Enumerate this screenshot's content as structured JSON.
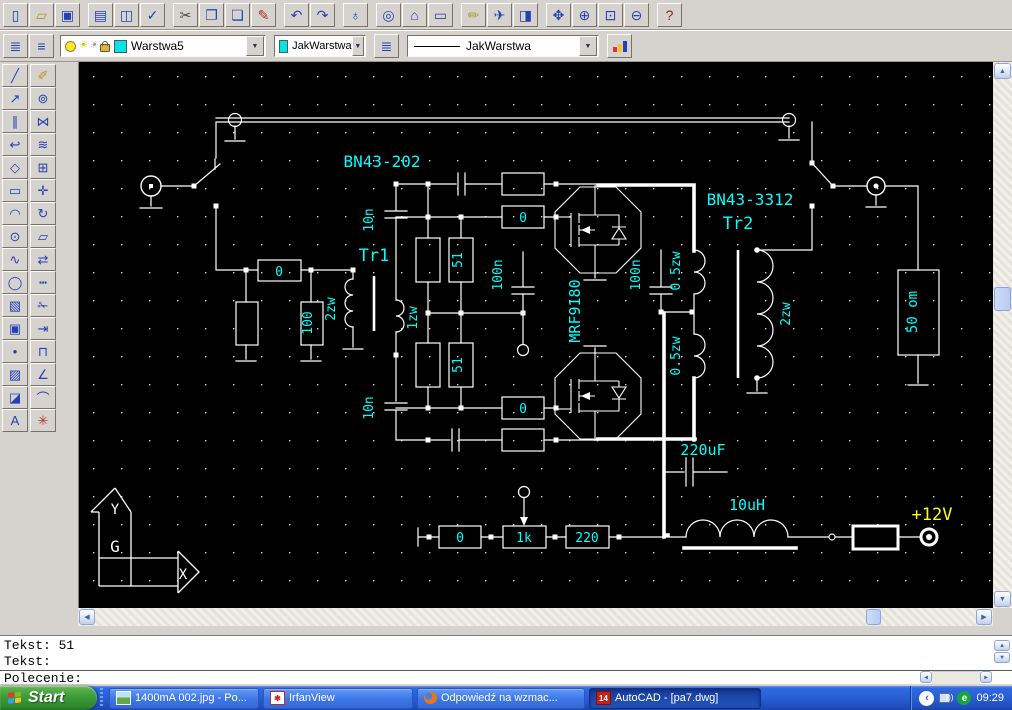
{
  "toolbars": {
    "standard": {
      "buttons": [
        {
          "name": "new",
          "glyph": "▯",
          "color": "#2440b4",
          "group": 1
        },
        {
          "name": "open",
          "glyph": "▱",
          "color": "#b8922a",
          "group": 1
        },
        {
          "name": "save",
          "glyph": "▣",
          "color": "#2440b4",
          "group": 1
        },
        {
          "name": "print",
          "glyph": "▤",
          "color": "#2440b4",
          "group": 2
        },
        {
          "name": "print-preview",
          "glyph": "◫",
          "color": "#2440b4",
          "group": 2
        },
        {
          "name": "spell-check",
          "glyph": "✓",
          "color": "#2440b4",
          "group": 2
        },
        {
          "name": "cut",
          "glyph": "✂",
          "color": "#44464a",
          "group": 3
        },
        {
          "name": "copy",
          "glyph": "❐",
          "color": "#2440b4",
          "group": 3
        },
        {
          "name": "paste",
          "glyph": "❏",
          "color": "#2440b4",
          "group": 3
        },
        {
          "name": "match-properties",
          "glyph": "✎",
          "color": "#b03030",
          "group": 3
        },
        {
          "name": "undo",
          "glyph": "↶",
          "color": "#2440b4",
          "group": 4
        },
        {
          "name": "redo",
          "glyph": "↷",
          "color": "#2440b4",
          "group": 4
        },
        {
          "name": "launch-browser",
          "glyph": "♁",
          "color": "#2440b4",
          "group": 5
        },
        {
          "name": "object-snap",
          "glyph": "◎",
          "color": "#2440b4",
          "group": 6
        },
        {
          "name": "insert-block",
          "glyph": "⌂",
          "color": "#2440b4",
          "group": 6
        },
        {
          "name": "measure",
          "glyph": "▭",
          "color": "#2440b4",
          "group": 6
        },
        {
          "name": "redraw",
          "glyph": "✏",
          "color": "#b8922a",
          "group": 7
        },
        {
          "name": "aerial-view",
          "glyph": "✈",
          "color": "#2440b4",
          "group": 7
        },
        {
          "name": "named-views",
          "glyph": "◨",
          "color": "#2440b4",
          "group": 7
        },
        {
          "name": "pan",
          "glyph": "✥",
          "color": "#2440b4",
          "group": 8
        },
        {
          "name": "zoom-realtime",
          "glyph": "⊕",
          "color": "#2440b4",
          "group": 8
        },
        {
          "name": "zoom-window",
          "glyph": "⊡",
          "color": "#2440b4",
          "group": 8
        },
        {
          "name": "zoom-previous",
          "glyph": "⊖",
          "color": "#2440b4",
          "group": 8
        },
        {
          "name": "help",
          "glyph": "?",
          "color": "#8a1f1f",
          "group": 9
        }
      ]
    },
    "properties": {
      "layers_button_glyph": "≣",
      "layer_stack_button_glyph": "≡",
      "layer_combo": {
        "value": "Warstwa5",
        "swatch": "#00e5e5"
      },
      "color_combo": {
        "value": "JakWarstwa",
        "swatch": "#00e5e5"
      },
      "linetype_button_glyph": "≣",
      "linetype_combo": {
        "value": "JakWarstwa"
      },
      "dropdown_glyph": "▼"
    },
    "draw": {
      "buttons": [
        {
          "name": "line",
          "glyph": "╱"
        },
        {
          "name": "construction-line",
          "glyph": "↗"
        },
        {
          "name": "multiline",
          "glyph": "∥"
        },
        {
          "name": "polyline",
          "glyph": "↩"
        },
        {
          "name": "polygon",
          "glyph": "◇"
        },
        {
          "name": "rectangle",
          "glyph": "▭"
        },
        {
          "name": "arc",
          "glyph": "◠"
        },
        {
          "name": "circle",
          "glyph": "⊙"
        },
        {
          "name": "spline",
          "glyph": "∿"
        },
        {
          "name": "ellipse",
          "glyph": "◯"
        },
        {
          "name": "insert-block",
          "glyph": "▧"
        },
        {
          "name": "make-block",
          "glyph": "▣"
        },
        {
          "name": "point",
          "glyph": "•"
        },
        {
          "name": "hatch",
          "glyph": "▨"
        },
        {
          "name": "region",
          "glyph": "◪"
        },
        {
          "name": "text",
          "glyph": "A"
        }
      ]
    },
    "modify": {
      "buttons": [
        {
          "name": "erase",
          "glyph": "✐",
          "color": "#b8922a"
        },
        {
          "name": "copy-object",
          "glyph": "⊚"
        },
        {
          "name": "mirror",
          "glyph": "⋈"
        },
        {
          "name": "offset",
          "glyph": "≋"
        },
        {
          "name": "array",
          "glyph": "⊞"
        },
        {
          "name": "move",
          "glyph": "✛"
        },
        {
          "name": "rotate",
          "glyph": "↻"
        },
        {
          "name": "scale",
          "glyph": "▱"
        },
        {
          "name": "stretch",
          "glyph": "⇄"
        },
        {
          "name": "lengthen",
          "glyph": "┅"
        },
        {
          "name": "trim",
          "glyph": "✁"
        },
        {
          "name": "extend",
          "glyph": "⇥"
        },
        {
          "name": "break",
          "glyph": "⊓"
        },
        {
          "name": "chamfer",
          "glyph": "∠"
        },
        {
          "name": "fillet",
          "glyph": "⌒"
        },
        {
          "name": "explode",
          "glyph": "✳",
          "color": "#b03030"
        }
      ]
    }
  },
  "drawing": {
    "labels": {
      "bn43_202": "BN43-202",
      "tr1": "Tr1",
      "cap_top": "10n",
      "cap_bottom": "10n",
      "r_in": "0",
      "r100": "100",
      "tr1_pri": "2zw",
      "tr1_sec": "1zw",
      "r51_a": "51",
      "r51_b": "51",
      "c100n_a": "100n",
      "c100n_b": "100n",
      "r0_a": "0",
      "r0_b": "0",
      "mosfet": "MRF9180",
      "w05_a": "0.5zw",
      "w05_b": "0.5zw",
      "bn43_3312": "BN43-3312",
      "tr2": "Tr2",
      "tr2_sec": "2zw",
      "load": "50 om",
      "c220": "220uF",
      "l10": "10uH",
      "v12": "+12V",
      "rb0": "0",
      "rb1k": "1k",
      "rb220": "220"
    },
    "ucs": {
      "x_label": "X",
      "y_label": "Y",
      "origin_label": "G"
    }
  },
  "command_window": {
    "history": [
      "Tekst: 51",
      "Tekst:"
    ],
    "prompt": "Polecenie:"
  },
  "taskbar": {
    "start_label": "Start",
    "tasks": [
      {
        "label": "1400mA 002.jpg - Po...",
        "icon": "image-file",
        "active": false
      },
      {
        "label": "IrfanView",
        "icon": "irfanview",
        "active": false
      },
      {
        "label": "Odpowiedź na wzmac...",
        "icon": "firefox",
        "active": false
      },
      {
        "label": "AutoCAD - [pa7.dwg]",
        "icon": "autocad-r14",
        "active": true
      }
    ],
    "clock": "09:29"
  },
  "colors": {
    "schematic_line": "#ffffff",
    "schematic_text": "#00ffff",
    "supply_text": "#ffff00",
    "canvas_bg": "#000000",
    "layer_swatch": "#00e5e5"
  }
}
